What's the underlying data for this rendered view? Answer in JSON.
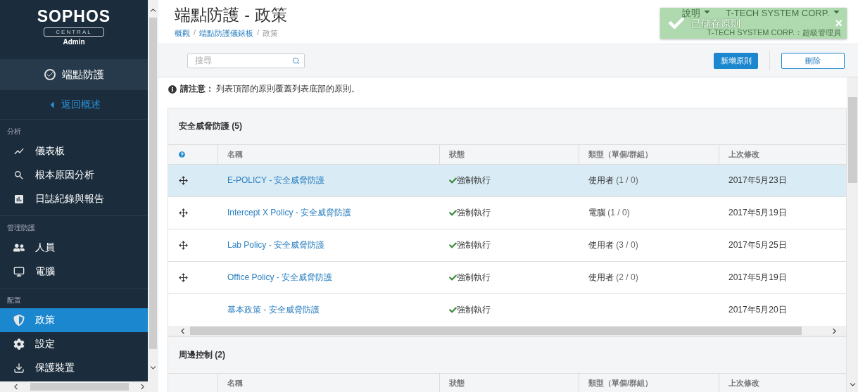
{
  "sidebar": {
    "logo": {
      "brand": "SOPHOS",
      "product": "CENTRAL",
      "role": "Admin"
    },
    "module": "端點防護",
    "back_link": "返回概述",
    "sections": [
      {
        "title": "分析",
        "items": [
          {
            "label": "儀表板",
            "selected": false
          },
          {
            "label": "根本原因分析",
            "selected": false
          },
          {
            "label": "日誌紀錄與報告",
            "selected": false
          }
        ]
      },
      {
        "title": "管理防護",
        "items": [
          {
            "label": "人員",
            "selected": false
          },
          {
            "label": "電腦",
            "selected": false
          }
        ]
      },
      {
        "title": "配置",
        "items": [
          {
            "label": "政策",
            "selected": true
          },
          {
            "label": "設定",
            "selected": false
          },
          {
            "label": "保護裝置",
            "selected": false
          }
        ]
      }
    ]
  },
  "header": {
    "title": "端點防護 - 政策",
    "breadcrumb_separator": "/",
    "breadcrumbs": [
      {
        "label": "概觀",
        "link": true
      },
      {
        "label": "端點防護儀錶板",
        "link": true
      },
      {
        "label": "政策",
        "link": false
      }
    ],
    "help": "說明",
    "account": "T-TECH SYSTEM CORP.",
    "account_role": "T-TECH SYSTEM CORP.：超級管理員"
  },
  "toast": {
    "message": "已儲存原則",
    "close": "×"
  },
  "toolbar": {
    "search": {
      "placeholder": "搜尋"
    },
    "buttons": [
      {
        "kind": "primary",
        "label": "新增原則"
      },
      {
        "kind": "outline",
        "label": "刪除"
      }
    ]
  },
  "note": {
    "label": "請注意：",
    "text": "列表頂部的原則覆蓋列表底部的原則。"
  },
  "groups": [
    {
      "title": "安全威脅防護",
      "count": "(5)",
      "help": true,
      "columns": [
        "名稱",
        "狀態",
        "類型（單個/群組）",
        "上次修改"
      ],
      "scrollbar": true,
      "rows": [
        {
          "draggable": true,
          "selected": true,
          "name": "E-POLICY - 安全威脅防護",
          "status": "強制執行",
          "type": "使用者",
          "counts": "(1 / 0)",
          "modified": "2017年5月23日"
        },
        {
          "draggable": true,
          "selected": false,
          "name": "Intercept X Policy - 安全威脅防護",
          "status": "強制執行",
          "type": "電腦",
          "counts": "(1 / 0)",
          "modified": "2017年5月19日"
        },
        {
          "draggable": true,
          "selected": false,
          "name": "Lab Policy - 安全威脅防護",
          "status": "強制執行",
          "type": "使用者",
          "counts": "(3 / 0)",
          "modified": "2017年5月25日"
        },
        {
          "draggable": true,
          "selected": false,
          "name": "Office Policy - 安全威脅防護",
          "status": "強制執行",
          "type": "使用者",
          "counts": "(2 / 0)",
          "modified": "2017年5月19日"
        },
        {
          "draggable": false,
          "selected": false,
          "name": "基本政策 - 安全威脅防護",
          "status": "強制執行",
          "modified": "2017年5月20日"
        }
      ]
    },
    {
      "title": "周邊控制",
      "count": "(2)",
      "help": false,
      "columns": [
        "名稱",
        "狀態",
        "類型（單個/群組）",
        "上次修改"
      ]
    }
  ]
}
